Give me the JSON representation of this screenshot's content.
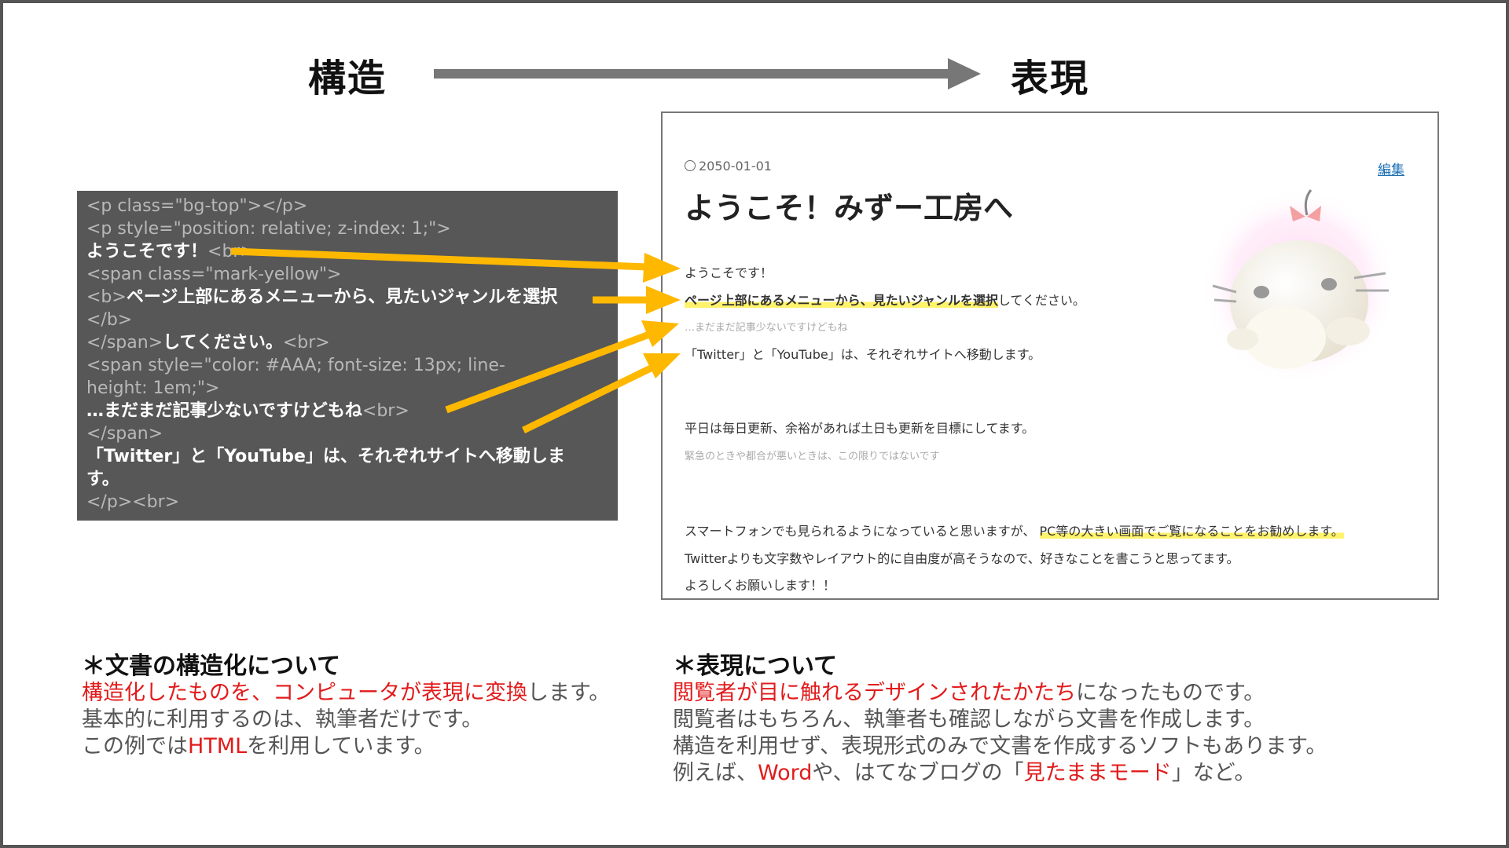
{
  "titles": {
    "left": "構造",
    "right": "表現"
  },
  "code_lines": [
    {
      "parts": [
        {
          "t": "<p class=\"bg-top\"></p>",
          "w": false
        }
      ]
    },
    {
      "parts": [
        {
          "t": "<p style=\"position: relative; z-index: 1;\">",
          "w": false
        }
      ]
    },
    {
      "parts": [
        {
          "t": "ようこそです！",
          "w": true
        },
        {
          "t": "<br>",
          "w": false
        }
      ]
    },
    {
      "parts": [
        {
          "t": "<span class=\"mark-yellow\">",
          "w": false
        }
      ]
    },
    {
      "parts": [
        {
          "t": "<b>",
          "w": false
        },
        {
          "t": "ページ上部にあるメニューから、見たいジャンルを選択",
          "w": true
        }
      ]
    },
    {
      "parts": [
        {
          "t": "</b>",
          "w": false
        }
      ]
    },
    {
      "parts": [
        {
          "t": "</span>",
          "w": false
        },
        {
          "t": "してください。",
          "w": true
        },
        {
          "t": "<br>",
          "w": false
        }
      ]
    },
    {
      "parts": [
        {
          "t": "<span style=\"color: #AAA; font-size: 13px; line-",
          "w": false
        }
      ]
    },
    {
      "parts": [
        {
          "t": "height: 1em;\">",
          "w": false
        }
      ]
    },
    {
      "parts": [
        {
          "t": "…まだまだ記事少ないですけどもね",
          "w": true
        },
        {
          "t": "<br>",
          "w": false
        }
      ]
    },
    {
      "parts": [
        {
          "t": "</span>",
          "w": false
        }
      ]
    },
    {
      "parts": [
        {
          "t": "「Twitter」と「YouTube」は、それぞれサイトへ移動しま",
          "w": true
        }
      ]
    },
    {
      "parts": [
        {
          "t": "す。",
          "w": true
        }
      ]
    },
    {
      "parts": [
        {
          "t": "</p><br>",
          "w": false
        }
      ]
    }
  ],
  "preview": {
    "date": "2050-01-01",
    "edit": "編集",
    "heading": "ようこそ！みずー工房へ",
    "line1": "ようこそです！",
    "line2_bold": "ページ上部にあるメニューから、見たいジャンルを選択",
    "line2_rest": "してください。",
    "line3": "…まだまだ記事少ないですけどもね",
    "line4": "「Twitter」と「YouTube」は、それぞれサイトへ移動します。",
    "line5": "平日は毎日更新、余裕があれば土日も更新を目標にしてます。",
    "line6": "緊急のときや都合が悪いときは、この限りではないです",
    "line7_plain": "スマートフォンでも見られるようになっていると思いますが、",
    "line7_hl": "PC等の大きい画面でご覧になることをお勧めします。",
    "line8": "Twitterよりも文字数やレイアウト的に自由度が高そうなので、好きなことを書こうと思ってます。",
    "line9": "よろしくお願いします！！"
  },
  "notes": {
    "left": {
      "heading": "＊文書の構造化について",
      "l1_red": "構造化したものを、コンピュータが表現に変換",
      "l1_rest": "します。",
      "l2": "基本的に利用するのは、執筆者だけです。",
      "l3_a": "この例では",
      "l3_red": "HTML",
      "l3_b": "を利用しています。"
    },
    "right": {
      "heading": "＊表現について",
      "l1_red": "閲覧者が目に触れるデザインされたかたち",
      "l1_rest": "になったものです。",
      "l2": "閲覧者はもちろん、執筆者も確認しながら文書を作成します。",
      "l3": "構造を利用せず、表現形式のみで文書を作成するソフトもあります。",
      "l4_a": "例えば、",
      "l4_red1": "Word",
      "l4_b": "や、はてなブログの「",
      "l4_red2": "見たままモード",
      "l4_c": "」など。"
    }
  },
  "colors": {
    "arrow": "#ffb800",
    "highlight": "#fff36b",
    "red": "#e21b1b",
    "code_bg": "#575757"
  }
}
